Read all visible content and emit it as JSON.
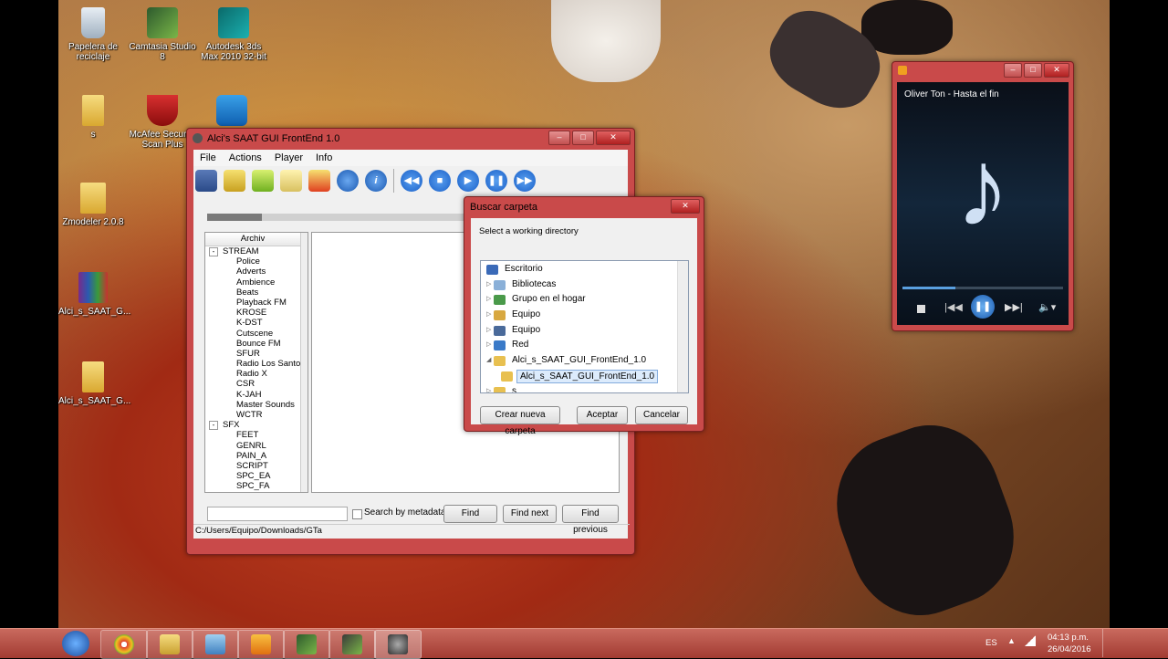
{
  "desktop_icons": [
    {
      "label": "Papelera de reciclaje",
      "icon": "recycle-bin-icon"
    },
    {
      "label": "Camtasia Studio 8",
      "icon": "camtasia-icon"
    },
    {
      "label": "Autodesk 3ds Max 2010 32-bit",
      "icon": "3dsmax-icon"
    },
    {
      "label": "s",
      "icon": "folder-icon"
    },
    {
      "label": "McAfee Security Scan Plus",
      "icon": "mcafee-icon"
    },
    {
      "label": "",
      "icon": "teamviewer-icon"
    },
    {
      "label": "Zmodeler 2.0.8",
      "icon": "folder-icon"
    },
    {
      "label": "Alci_s_SAAT_G...",
      "icon": "winrar-icon"
    },
    {
      "label": "Alci_s_SAAT_G...",
      "icon": "folder-icon"
    }
  ],
  "saat": {
    "title": "Alci's SAAT GUI FrontEnd 1.0",
    "menu": [
      "File",
      "Actions",
      "Player",
      "Info"
    ],
    "tree_header": "Archiv",
    "tree": [
      {
        "label": "STREAM",
        "level": 0,
        "expander": "-"
      },
      {
        "label": "Police",
        "level": 1
      },
      {
        "label": "Adverts",
        "level": 1
      },
      {
        "label": "Ambience",
        "level": 1
      },
      {
        "label": "Beats",
        "level": 1
      },
      {
        "label": "Playback FM",
        "level": 1
      },
      {
        "label": "KROSE",
        "level": 1
      },
      {
        "label": "K-DST",
        "level": 1
      },
      {
        "label": "Cutscene",
        "level": 1
      },
      {
        "label": "Bounce FM",
        "level": 1
      },
      {
        "label": "SFUR",
        "level": 1
      },
      {
        "label": "Radio Los Santos",
        "level": 1
      },
      {
        "label": "Radio X",
        "level": 1
      },
      {
        "label": "CSR",
        "level": 1
      },
      {
        "label": "K-JAH",
        "level": 1
      },
      {
        "label": "Master Sounds",
        "level": 1
      },
      {
        "label": "WCTR",
        "level": 1
      },
      {
        "label": "SFX",
        "level": 0,
        "expander": "-"
      },
      {
        "label": "FEET",
        "level": 1
      },
      {
        "label": "GENRL",
        "level": 1
      },
      {
        "label": "PAIN_A",
        "level": 1
      },
      {
        "label": "SCRIPT",
        "level": 1
      },
      {
        "label": "SPC_EA",
        "level": 1
      },
      {
        "label": "SPC_FA",
        "level": 1
      }
    ],
    "search_value": "",
    "search_by_metadata": "Search by metadata",
    "find": "Find",
    "find_next": "Find next",
    "find_previous": "Find previous",
    "status_path": "C:/Users/Equipo/Downloads/GTa"
  },
  "browse": {
    "title": "Buscar carpeta",
    "prompt": "Select a working directory",
    "items": [
      {
        "label": "Escritorio",
        "level": 0,
        "icon": "desktop-icon",
        "expander": ""
      },
      {
        "label": "Bibliotecas",
        "level": 1,
        "icon": "libraries-icon",
        "expander": "▷"
      },
      {
        "label": "Grupo en el hogar",
        "level": 1,
        "icon": "homegroup-icon",
        "expander": "▷"
      },
      {
        "label": "Equipo",
        "level": 1,
        "icon": "user-icon",
        "expander": "▷"
      },
      {
        "label": "Equipo",
        "level": 1,
        "icon": "computer-icon",
        "expander": "▷"
      },
      {
        "label": "Red",
        "level": 1,
        "icon": "network-icon",
        "expander": "▷"
      },
      {
        "label": "Alci_s_SAAT_GUI_FrontEnd_1.0",
        "level": 1,
        "icon": "folder-icon",
        "expander": "◢"
      },
      {
        "label": "Alci_s_SAAT_GUI_FrontEnd_1.0",
        "level": 2,
        "icon": "folder-icon",
        "expander": "",
        "selected": true
      },
      {
        "label": "s",
        "level": 1,
        "icon": "folder-icon",
        "expander": "▷"
      }
    ],
    "new_folder": "Crear nueva carpeta",
    "ok": "Aceptar",
    "cancel": "Cancelar"
  },
  "player": {
    "now_playing": "Oliver Ton - Hasta el fin",
    "progress": 0.33,
    "note_glyph": "♪"
  },
  "taskbar": {
    "language": "ES",
    "time": "04:13 p.m.",
    "date": "26/04/2016",
    "buttons": [
      "chrome-icon",
      "explorer-icon",
      "book-icon",
      "media-player-icon",
      "camtasia-icon",
      "camtasia-recorder-icon",
      "saat-icon"
    ]
  },
  "colors": {
    "window_frame": "#c94a4a",
    "taskbar": "#a23b32",
    "player_bg": "#0d1a2a",
    "toolbar_blue": "#1f6fd1"
  }
}
